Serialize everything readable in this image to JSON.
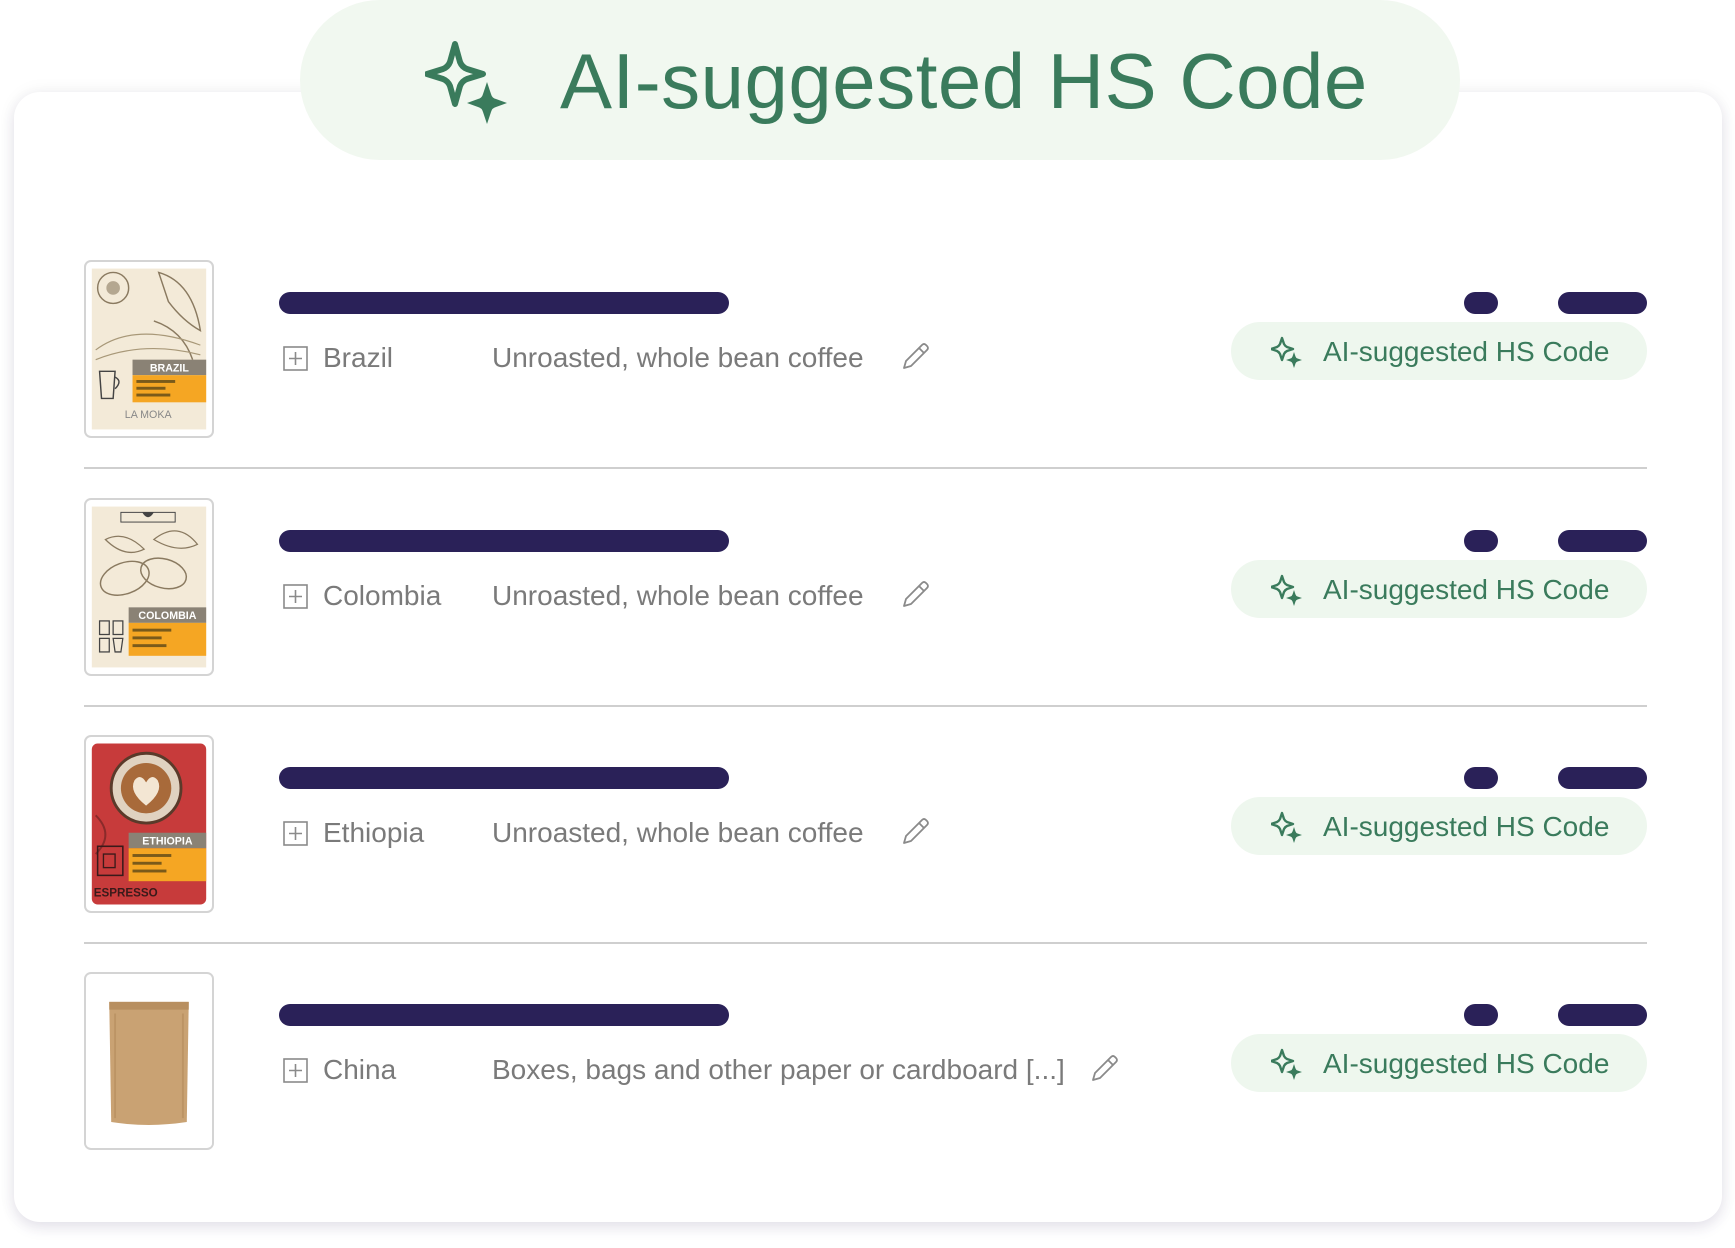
{
  "header": {
    "title": "AI-suggested HS Code",
    "icon": "sparkle-icon"
  },
  "colors": {
    "accent_green": "#3a7b5c",
    "pill_background": "#f1f8f0",
    "placeholder_bar": "#2a2158",
    "muted_text": "#7a7a7a"
  },
  "rows": [
    {
      "origin": "Brazil",
      "description": "Unroasted, whole bean coffee",
      "ai_button_label": "AI-suggested HS Code",
      "thumbnail": {
        "label": "BRAZIL",
        "footer": "LA MOKA"
      }
    },
    {
      "origin": "Colombia",
      "description": "Unroasted, whole bean coffee",
      "ai_button_label": "AI-suggested HS Code",
      "thumbnail": {
        "label": "COLOMBIA",
        "footer": ""
      }
    },
    {
      "origin": "Ethiopia",
      "description": "Unroasted, whole bean coffee",
      "ai_button_label": "AI-suggested HS Code",
      "thumbnail": {
        "label": "ETHIOPIA",
        "footer": "ESPRESSO"
      }
    },
    {
      "origin": "China",
      "description": "Boxes, bags and other paper or cardboard [...]",
      "ai_button_label": "AI-suggested HS Code",
      "thumbnail": {
        "label": "",
        "footer": ""
      }
    }
  ]
}
